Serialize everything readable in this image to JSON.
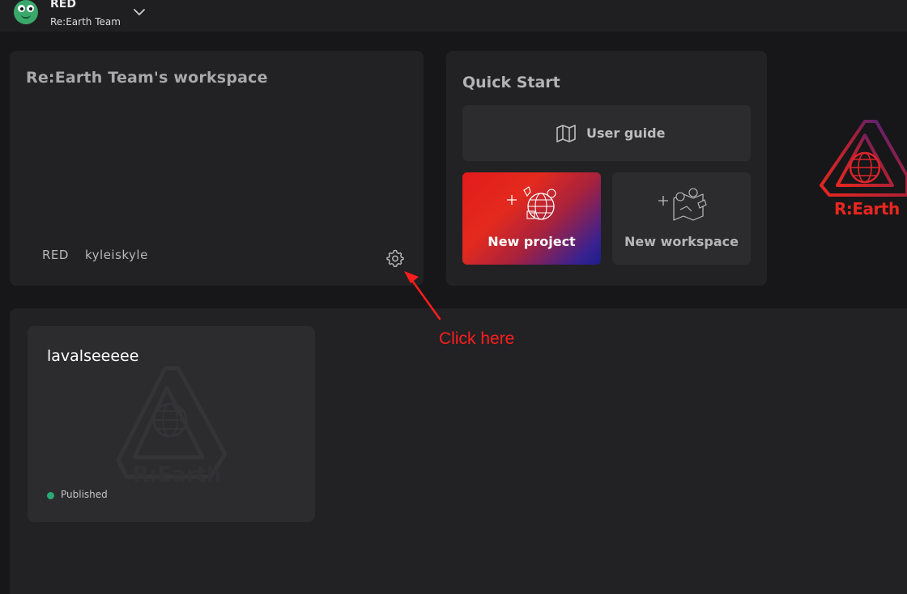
{
  "header": {
    "user_name": "RED",
    "team_name": "Re:Earth Team",
    "avatar_color": "#3aa86b",
    "dropdown_icon": "chevron-down-icon"
  },
  "workspace": {
    "title": "Re:Earth Team's workspace",
    "members": [
      "RED",
      "kyleiskyle"
    ],
    "settings_icon": "gear-icon"
  },
  "quick_start": {
    "title": "Quick Start",
    "user_guide_label": "User guide",
    "new_project_label": "New project",
    "new_workspace_label": "New workspace",
    "gradient_colors": [
      "#e31b1b",
      "#1b1e8c"
    ]
  },
  "brand": {
    "logo_text": "R:Earth",
    "accent_color": "#e8271f"
  },
  "projects": [
    {
      "name": "lavalseeeee",
      "status": "Published",
      "status_color": "#2aa876"
    }
  ],
  "annotation": {
    "text": "Click here",
    "color": "#ff1e1e"
  }
}
